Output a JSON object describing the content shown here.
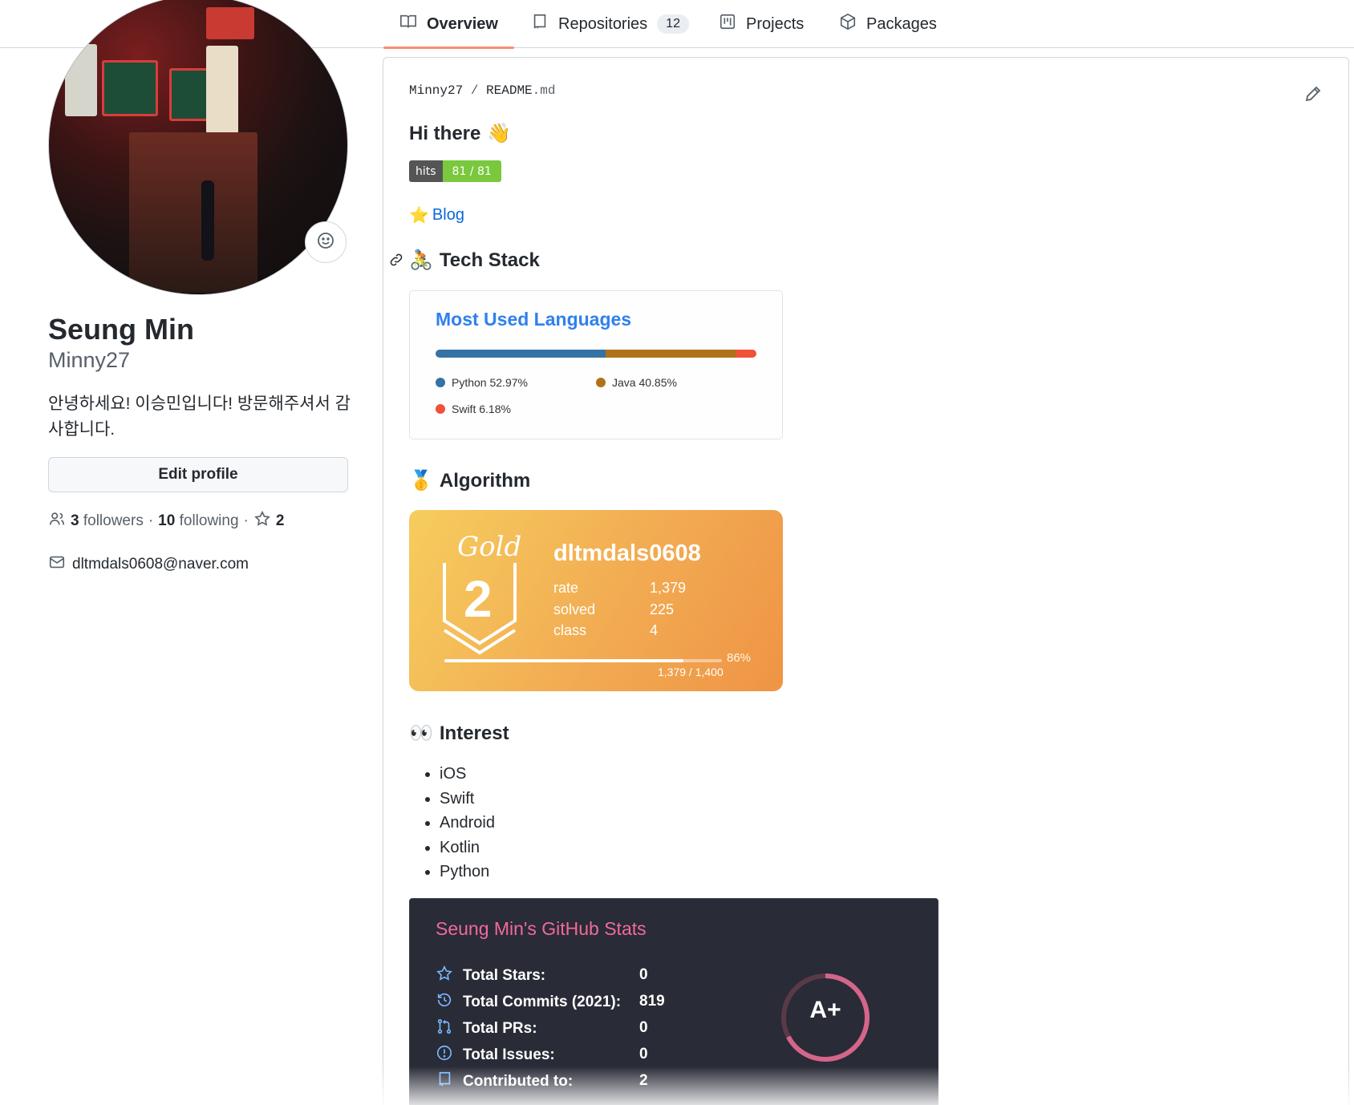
{
  "tabs": [
    {
      "label": "Overview",
      "icon": "book-icon"
    },
    {
      "label": "Repositories",
      "icon": "repo-icon",
      "count": "12"
    },
    {
      "label": "Projects",
      "icon": "project-icon"
    },
    {
      "label": "Packages",
      "icon": "package-icon"
    }
  ],
  "profile": {
    "name": "Seung Min",
    "username": "Minny27",
    "bio": "안녕하세요! 이승민입니다! 방문해주셔서 감사합니다.",
    "edit_label": "Edit profile",
    "followers_count": "3",
    "followers_label": "followers",
    "separator": "·",
    "following_count": "10",
    "following_label": "following",
    "stars_count": "2",
    "email": "dltmdals0608@naver.com"
  },
  "readme": {
    "path_user": "Minny27",
    "path_sep": "/",
    "path_file": "README",
    "path_ext": ".md",
    "greeting": "Hi there",
    "greeting_emoji": "👋",
    "hits_label": "hits",
    "hits_value": "81 / 81",
    "blog_emoji": "⭐",
    "blog_label": "Blog",
    "tech_emoji": "🚴",
    "tech_heading": "Tech Stack",
    "algo_emoji": "🥇",
    "algo_heading": "Algorithm",
    "interest_emoji": "👀",
    "interest_heading": "Interest",
    "interests": [
      "iOS",
      "Swift",
      "Android",
      "Kotlin",
      "Python"
    ]
  },
  "languages_card": {
    "title": "Most Used Languages",
    "items": [
      {
        "label": "Python 52.97%",
        "pct": 52.97,
        "color": "#3572A5"
      },
      {
        "label": "Java 40.85%",
        "pct": 40.85,
        "color": "#b07219"
      },
      {
        "label": "Swift 6.18%",
        "pct": 6.18,
        "color": "#F05138"
      }
    ]
  },
  "algo_card": {
    "tier_word": "Gold",
    "tier_num": "2",
    "handle": "dltmdals0608",
    "rows": [
      {
        "label": "rate",
        "value": "1,379"
      },
      {
        "label": "solved",
        "value": "225"
      },
      {
        "label": "class",
        "value": "4"
      }
    ],
    "progress_pct": "86%",
    "progress_fraction": 0.86,
    "progress_text": "1,379 / 1,400"
  },
  "stats_card": {
    "title": "Seung Min's GitHub Stats",
    "rows": [
      {
        "label": "Total Stars:",
        "value": "0",
        "icon": "star-icon"
      },
      {
        "label": "Total Commits (2021):",
        "value": "819",
        "icon": "history-icon"
      },
      {
        "label": "Total PRs:",
        "value": "0",
        "icon": "pull-request-icon"
      },
      {
        "label": "Total Issues:",
        "value": "0",
        "icon": "issue-icon"
      },
      {
        "label": "Contributed to:",
        "value": "2",
        "icon": "repo-icon"
      }
    ],
    "rank": "A+",
    "colors": {
      "bg": "#292b36",
      "title": "#f06a9a",
      "icon": "#79b8ff",
      "ring": "#d4658b"
    }
  }
}
